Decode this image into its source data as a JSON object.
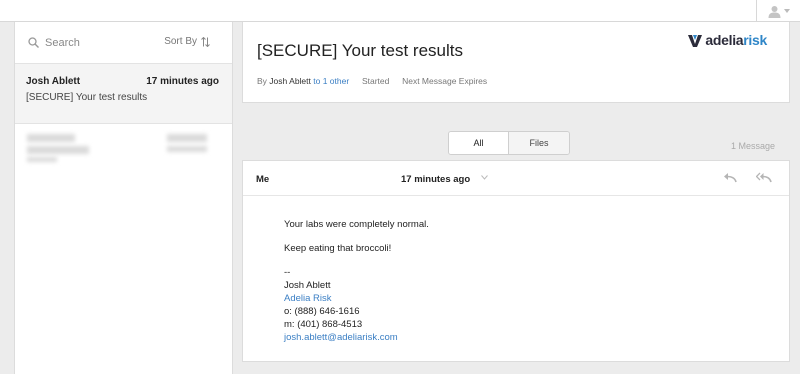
{
  "topbar": {
    "user_icon": "user-icon"
  },
  "sidebar": {
    "search": {
      "placeholder": "Search",
      "icon": "search-icon"
    },
    "sort_label": "Sort By",
    "sort_icon": "sort-arrows-icon",
    "messages": [
      {
        "sender": "Josh Ablett",
        "time": "17 minutes ago",
        "subject": "[SECURE] Your test results"
      }
    ]
  },
  "header": {
    "subject": "[SECURE] Your test results",
    "meta": {
      "by_label": "By",
      "from_name": "Josh Ablett",
      "to_other": "to 1 other",
      "started": "Started",
      "next_expires": "Next Message Expires"
    },
    "logo": {
      "part1": "adelia",
      "part2": "risk"
    }
  },
  "tabs": [
    {
      "label": "All"
    },
    {
      "label": "Files"
    }
  ],
  "message_count": "1 Message",
  "message": {
    "from": "Me",
    "time": "17 minutes ago",
    "body": {
      "line1": "Your labs were completely normal.",
      "line2": "Keep eating that broccoli!",
      "sig_sep": "--",
      "sig_name": "Josh Ablett",
      "sig_company": "Adelia Risk",
      "sig_office": "o: (888) 646-1616",
      "sig_mobile": "m: (401) 868-4513",
      "sig_email": "josh.ablett@adeliarisk.com"
    }
  },
  "colors": {
    "accent": "#3b7fc4",
    "logo_blue": "#2f86c8",
    "logo_dark": "#2b2b3a"
  }
}
